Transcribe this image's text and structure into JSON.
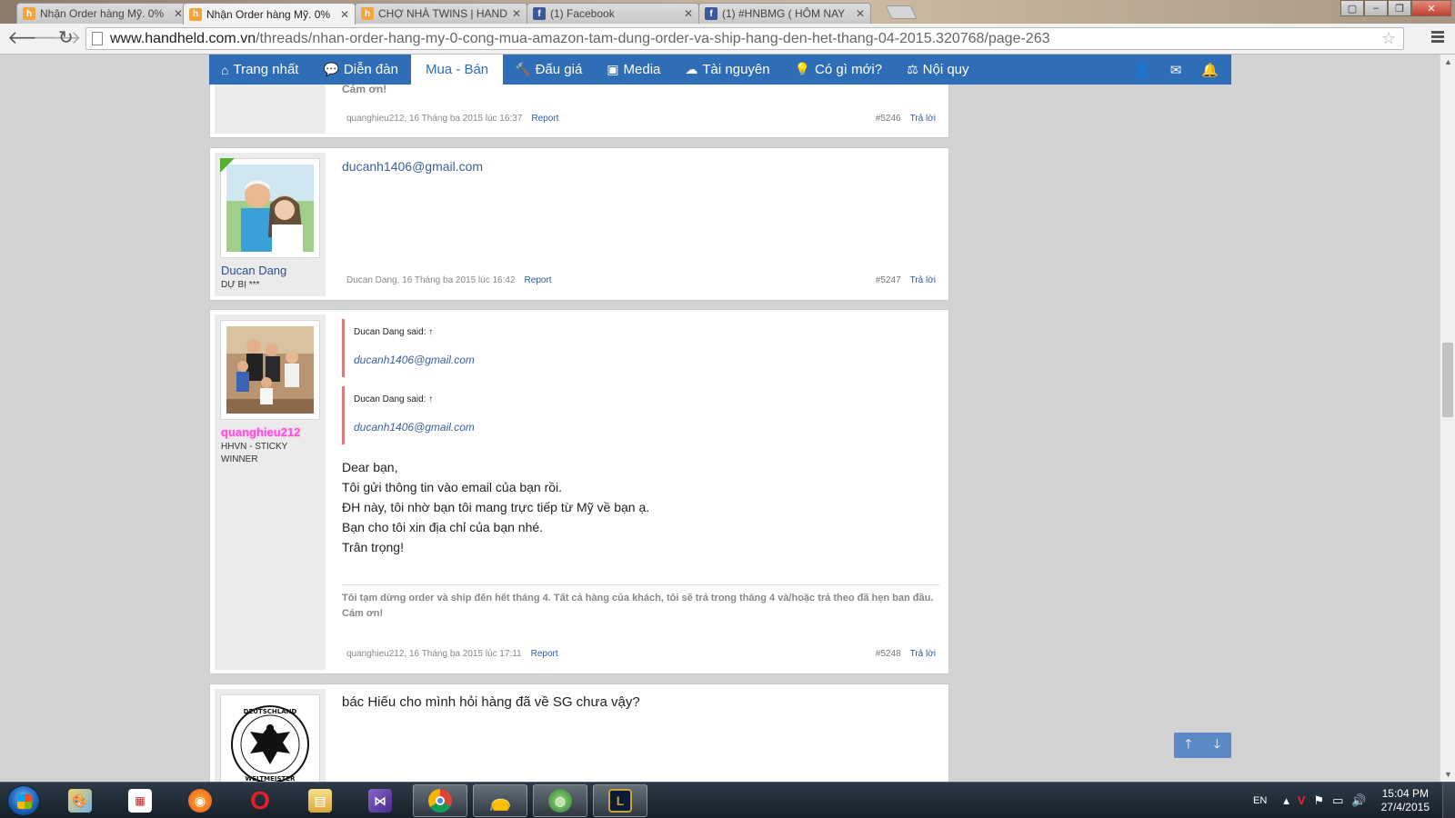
{
  "browser": {
    "tabs": [
      {
        "title": "Nhận Order hàng Mỹ. 0%",
        "favicon": "handheld-favicon",
        "active": false
      },
      {
        "title": "Nhận Order hàng Mỹ. 0%",
        "favicon": "handheld-favicon",
        "active": true
      },
      {
        "title": "CHỢ NHÀ TWINS | HAND",
        "favicon": "handheld-favicon",
        "active": false
      },
      {
        "title": "(1) Facebook",
        "favicon": "facebook-favicon",
        "active": false
      },
      {
        "title": "(1) #HNBMG ( HÔM NAY",
        "favicon": "facebook-favicon",
        "active": false
      }
    ],
    "url_host": "www.handheld.com.vn",
    "url_path": "/threads/nhan-order-hang-my-0-cong-mua-amazon-tam-dung-order-va-ship-hang-den-het-thang-04-2015.320768/page-263"
  },
  "forum_nav": {
    "items": [
      {
        "label": "Trang nhất",
        "icon": "home-icon"
      },
      {
        "label": "Diễn đàn",
        "icon": "chat-icon"
      },
      {
        "label": "Mua - Bán",
        "icon": "",
        "selected": true
      },
      {
        "label": "Đấu giá",
        "icon": "gavel-icon"
      },
      {
        "label": "Media",
        "icon": "image-icon"
      },
      {
        "label": "Tài nguyên",
        "icon": "cloud-download-icon"
      },
      {
        "label": "Có gì mới?",
        "icon": "lightbulb-icon"
      },
      {
        "label": "Nội quy",
        "icon": "scale-icon"
      }
    ],
    "right_icons": [
      "user-icon",
      "mail-icon",
      "bell-icon"
    ]
  },
  "posts": [
    {
      "partial_text": "Cám ơn!",
      "author": "quanghieu212",
      "date": "16 Tháng ba 2015 lúc 16:37",
      "report": "Report",
      "number": "#5246",
      "reply": "Trả lời"
    },
    {
      "author": "Ducan Dang",
      "user_title": "DỰ BỊ ***",
      "message": "ducanh1406@gmail.com",
      "date": "16 Tháng ba 2015 lúc 16:42",
      "report": "Report",
      "number": "#5247",
      "reply": "Trả lời"
    },
    {
      "author": "quanghieu212",
      "user_title": "HHVN - STICKY WINNER",
      "quotes": [
        {
          "said": "Ducan Dang said: ↑",
          "text": "ducanh1406@gmail.com"
        },
        {
          "said": "Ducan Dang said: ↑",
          "text": "ducanh1406@gmail.com"
        }
      ],
      "message": "Dear bạn,\nTôi gửi thông tin vào email của bạn rồi.\nĐH này, tôi nhờ bạn tôi mang trực tiếp từ Mỹ về bạn ạ.\nBạn cho tôi xin địa chỉ của bạn nhé.\nTrân trọng!",
      "signature": "Tôi tạm dừng order và ship đến hết tháng 4. Tất cả hàng của khách, tôi sẽ trả trong tháng 4 và/hoặc trả theo đã hẹn ban đầu.\nCám ơn!",
      "date": "16 Tháng ba 2015 lúc 17:11",
      "report": "Report",
      "number": "#5248",
      "reply": "Trả lời"
    },
    {
      "avatar_text": "DEUTSCHLAND WELTMEISTER",
      "message": "bác Hiếu cho mình hỏi hàng đã về SG chưa vậy?"
    }
  ],
  "taskbar": {
    "apps": [
      "paint-icon",
      "media-center-icon",
      "firefox-icon",
      "opera-icon",
      "explorer-folder-icon",
      "visual-studio-icon",
      "chrome-icon",
      "red-bag-icon",
      "network-globe-icon",
      "league-of-legends-icon"
    ],
    "language": "EN",
    "time": "15:04 PM",
    "date": "27/4/2015"
  },
  "colors": {
    "forum_blue": "#2f6db7",
    "link_blue": "#3a5fa0",
    "quote_border": "#e07a7a",
    "magenta_name": "#ff4fd8"
  }
}
